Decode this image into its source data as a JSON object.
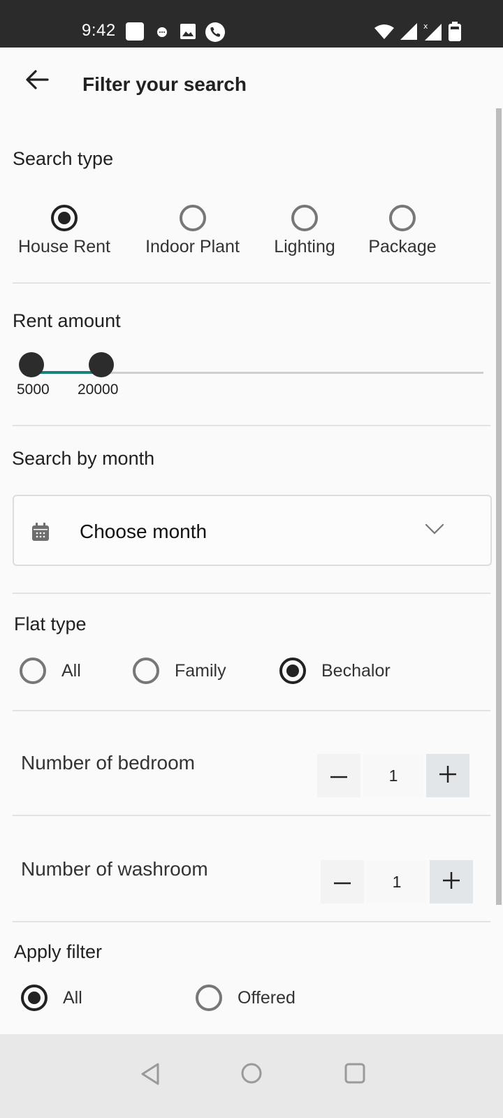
{
  "status_bar": {
    "time": "9:42",
    "icons": [
      "app-square-icon",
      "chat-bubble-icon",
      "image-icon",
      "phone-icon",
      "wifi-icon",
      "signal-icon",
      "signal-no-sim-icon",
      "battery-icon"
    ]
  },
  "header": {
    "back_icon": "arrow-left-icon",
    "title": "Filter your search"
  },
  "search_type": {
    "label": "Search type",
    "options": [
      {
        "label": "House Rent",
        "selected": true
      },
      {
        "label": "Indoor Plant",
        "selected": false
      },
      {
        "label": "Lighting",
        "selected": false
      },
      {
        "label": "Package",
        "selected": false
      }
    ]
  },
  "rent_amount": {
    "label": "Rent amount",
    "min_value": "5000",
    "max_value": "20000",
    "accent_color": "#1b7f7a"
  },
  "search_by_month": {
    "label": "Search by month",
    "placeholder": "Choose month",
    "calendar_icon": "calendar-icon",
    "chevron_icon": "chevron-down-icon"
  },
  "flat_type": {
    "label": "Flat type",
    "options": [
      {
        "label": "All",
        "selected": false
      },
      {
        "label": "Family",
        "selected": false
      },
      {
        "label": "Bechalor",
        "selected": true
      }
    ]
  },
  "bedrooms": {
    "label": "Number of bedroom",
    "value": "1"
  },
  "washrooms": {
    "label": "Number of washroom",
    "value": "1"
  },
  "apply_filter": {
    "label": "Apply filter",
    "options": [
      {
        "label": "All",
        "selected": true
      },
      {
        "label": "Offered",
        "selected": false
      }
    ]
  },
  "nav_bar": {
    "icons": [
      "nav-back-icon",
      "nav-home-icon",
      "nav-recents-icon"
    ]
  }
}
